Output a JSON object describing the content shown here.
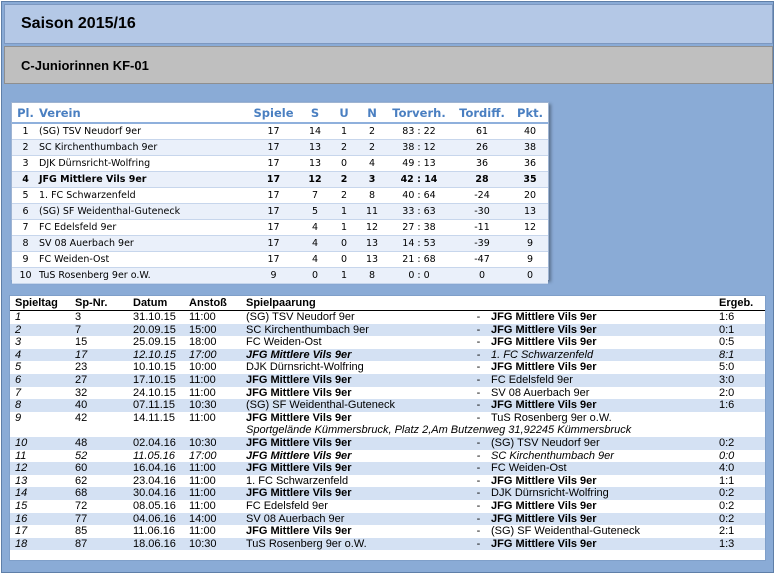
{
  "header": {
    "season": "Saison 2015/16",
    "league": "C-Juniorinnen  KF-01"
  },
  "standings": {
    "columns": [
      "Pl.",
      "Verein",
      "Spiele",
      "S",
      "U",
      "N",
      "Torverh.",
      "Tordiff.",
      "Pkt."
    ],
    "rows": [
      {
        "pl": "1",
        "verein": "(SG) TSV Neudorf 9er",
        "spiele": "17",
        "s": "14",
        "u": "1",
        "n": "2",
        "torverh": "83 : 22",
        "tordiff": "61",
        "pkt": "40",
        "highlight": false
      },
      {
        "pl": "2",
        "verein": "SC Kirchenthumbach 9er",
        "spiele": "17",
        "s": "13",
        "u": "2",
        "n": "2",
        "torverh": "38 : 12",
        "tordiff": "26",
        "pkt": "38",
        "highlight": false
      },
      {
        "pl": "3",
        "verein": "DJK Dürnsricht-Wolfring",
        "spiele": "17",
        "s": "13",
        "u": "0",
        "n": "4",
        "torverh": "49 : 13",
        "tordiff": "36",
        "pkt": "36",
        "highlight": false
      },
      {
        "pl": "4",
        "verein": "JFG Mittlere Vils 9er",
        "spiele": "17",
        "s": "12",
        "u": "2",
        "n": "3",
        "torverh": "42 : 14",
        "tordiff": "28",
        "pkt": "35",
        "highlight": true
      },
      {
        "pl": "5",
        "verein": "1. FC Schwarzenfeld",
        "spiele": "17",
        "s": "7",
        "u": "2",
        "n": "8",
        "torverh": "40 : 64",
        "tordiff": "-24",
        "pkt": "20",
        "highlight": false
      },
      {
        "pl": "6",
        "verein": "(SG) SF Weidenthal-Guteneck",
        "spiele": "17",
        "s": "5",
        "u": "1",
        "n": "11",
        "torverh": "33 : 63",
        "tordiff": "-30",
        "pkt": "13",
        "highlight": false
      },
      {
        "pl": "7",
        "verein": "FC Edelsfeld 9er",
        "spiele": "17",
        "s": "4",
        "u": "1",
        "n": "12",
        "torverh": "27 : 38",
        "tordiff": "-11",
        "pkt": "12",
        "highlight": false
      },
      {
        "pl": "8",
        "verein": "SV 08 Auerbach 9er",
        "spiele": "17",
        "s": "4",
        "u": "0",
        "n": "13",
        "torverh": "14 : 53",
        "tordiff": "-39",
        "pkt": "9",
        "highlight": false
      },
      {
        "pl": "9",
        "verein": "FC Weiden-Ost",
        "spiele": "17",
        "s": "4",
        "u": "0",
        "n": "13",
        "torverh": "21 : 68",
        "tordiff": "-47",
        "pkt": "9",
        "highlight": false
      },
      {
        "pl": "10",
        "verein": "TuS Rosenberg 9er o.W.",
        "spiele": "9",
        "s": "0",
        "u": "1",
        "n": "8",
        "torverh": "0 : 0",
        "tordiff": "0",
        "pkt": "0",
        "highlight": false
      }
    ]
  },
  "matches": {
    "columns": [
      "Spieltag",
      "Sp-Nr.",
      "Datum",
      "Anstoß",
      "Spielpaarung",
      "",
      "",
      "Ergeb."
    ],
    "rows": [
      {
        "spieltag": "1",
        "nr": "3",
        "datum": "31.10.15",
        "anstoss": "11:00",
        "home": "(SG) TSV Neudorf 9er",
        "away": "JFG Mittlere Vils 9er",
        "ergebnis": "1:6",
        "italic": false,
        "home_bold": false,
        "away_bold": true
      },
      {
        "spieltag": "2",
        "nr": "7",
        "datum": "20.09.15",
        "anstoss": "15:00",
        "home": "SC Kirchenthumbach 9er",
        "away": "JFG Mittlere Vils 9er",
        "ergebnis": "0:1",
        "italic": false,
        "home_bold": false,
        "away_bold": true
      },
      {
        "spieltag": "3",
        "nr": "15",
        "datum": "25.09.15",
        "anstoss": "18:00",
        "home": "FC Weiden-Ost",
        "away": "JFG Mittlere Vils 9er",
        "ergebnis": "0:5",
        "italic": false,
        "home_bold": false,
        "away_bold": true
      },
      {
        "spieltag": "4",
        "nr": "17",
        "datum": "12.10.15",
        "anstoss": "17:00",
        "home": "JFG Mittlere Vils 9er",
        "away": "1. FC Schwarzenfeld",
        "ergebnis": "8:1",
        "italic": true,
        "home_bold": true,
        "away_bold": false
      },
      {
        "spieltag": "5",
        "nr": "23",
        "datum": "10.10.15",
        "anstoss": "10:00",
        "home": "DJK Dürnsricht-Wolfring",
        "away": "JFG Mittlere Vils 9er",
        "ergebnis": "5:0",
        "italic": false,
        "home_bold": false,
        "away_bold": true
      },
      {
        "spieltag": "6",
        "nr": "27",
        "datum": "17.10.15",
        "anstoss": "11:00",
        "home": "JFG Mittlere Vils 9er",
        "away": "FC Edelsfeld 9er",
        "ergebnis": "3:0",
        "italic": false,
        "home_bold": true,
        "away_bold": false
      },
      {
        "spieltag": "7",
        "nr": "32",
        "datum": "24.10.15",
        "anstoss": "11:00",
        "home": "JFG Mittlere Vils 9er",
        "away": "SV 08 Auerbach 9er",
        "ergebnis": "2:0",
        "italic": false,
        "home_bold": true,
        "away_bold": false
      },
      {
        "spieltag": "8",
        "nr": "40",
        "datum": "07.11.15",
        "anstoss": "10:30",
        "home": "(SG) SF Weidenthal-Guteneck",
        "away": "JFG Mittlere Vils 9er",
        "ergebnis": "1:6",
        "italic": false,
        "home_bold": false,
        "away_bold": true
      },
      {
        "spieltag": "9",
        "nr": "42",
        "datum": "14.11.15",
        "anstoss": "11:00",
        "home": "JFG Mittlere Vils 9er",
        "away": "TuS Rosenberg 9er o.W.",
        "ergebnis": "",
        "italic": false,
        "home_bold": true,
        "away_bold": false
      },
      {
        "spieltag": "10",
        "nr": "48",
        "datum": "02.04.16",
        "anstoss": "10:30",
        "home": "JFG Mittlere Vils 9er",
        "away": "(SG) TSV Neudorf 9er",
        "ergebnis": "0:2",
        "italic": false,
        "home_bold": true,
        "away_bold": false
      },
      {
        "spieltag": "11",
        "nr": "52",
        "datum": "11.05.16",
        "anstoss": "17:00",
        "home": "JFG Mittlere Vils 9er",
        "away": "SC Kirchenthumbach 9er",
        "ergebnis": "0:0",
        "italic": true,
        "home_bold": true,
        "away_bold": false
      },
      {
        "spieltag": "12",
        "nr": "60",
        "datum": "16.04.16",
        "anstoss": "11:00",
        "home": "JFG Mittlere Vils 9er",
        "away": "FC Weiden-Ost",
        "ergebnis": "4:0",
        "italic": false,
        "home_bold": true,
        "away_bold": false
      },
      {
        "spieltag": "13",
        "nr": "62",
        "datum": "23.04.16",
        "anstoss": "11:00",
        "home": "1. FC Schwarzenfeld",
        "away": "JFG Mittlere Vils 9er",
        "ergebnis": "1:1",
        "italic": false,
        "home_bold": false,
        "away_bold": true
      },
      {
        "spieltag": "14",
        "nr": "68",
        "datum": "30.04.16",
        "anstoss": "11:00",
        "home": "JFG Mittlere Vils 9er",
        "away": "DJK Dürnsricht-Wolfring",
        "ergebnis": "0:2",
        "italic": false,
        "home_bold": true,
        "away_bold": false
      },
      {
        "spieltag": "15",
        "nr": "72",
        "datum": "08.05.16",
        "anstoss": "11:00",
        "home": "FC Edelsfeld 9er",
        "away": "JFG Mittlere Vils 9er",
        "ergebnis": "0:2",
        "italic": false,
        "home_bold": false,
        "away_bold": true
      },
      {
        "spieltag": "16",
        "nr": "77",
        "datum": "04.06.16",
        "anstoss": "14:00",
        "home": "SV 08 Auerbach 9er",
        "away": "JFG Mittlere Vils 9er",
        "ergebnis": "0:2",
        "italic": false,
        "home_bold": false,
        "away_bold": true
      },
      {
        "spieltag": "17",
        "nr": "85",
        "datum": "11.06.16",
        "anstoss": "11:00",
        "home": "JFG Mittlere Vils 9er",
        "away": "(SG) SF Weidenthal-Guteneck",
        "ergebnis": "2:1",
        "italic": false,
        "home_bold": true,
        "away_bold": false
      },
      {
        "spieltag": "18",
        "nr": "87",
        "datum": "18.06.16",
        "anstoss": "10:30",
        "home": "TuS Rosenberg 9er o.W.",
        "away": "JFG Mittlere Vils 9er",
        "ergebnis": "1:3",
        "italic": false,
        "home_bold": false,
        "away_bold": true
      }
    ],
    "venue_note": "Sportgelände Kümmersbruck, Platz 2,Am Butzenweg 31,92245 Kümmersbruck",
    "venue_after_index": 8
  },
  "colors": {
    "frame": "#8aabd6",
    "header_bar": "#b4c8e6",
    "league_bar": "#bfbfbf",
    "standings_header_text": "#4a7fc1",
    "match_alt_row": "#d4e1f3"
  }
}
